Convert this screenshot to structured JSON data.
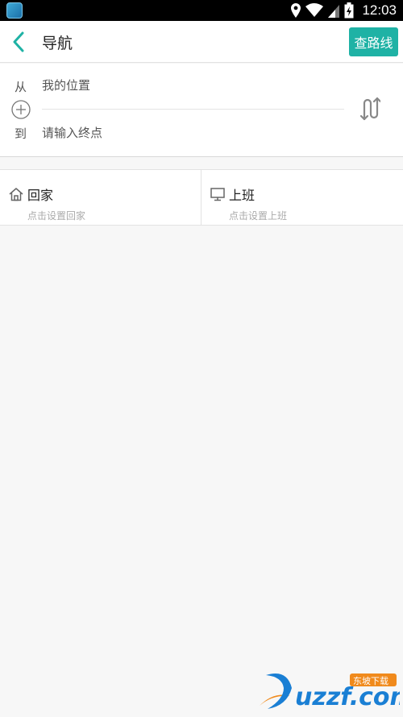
{
  "status_bar": {
    "time": "12:03"
  },
  "header": {
    "title": "导航",
    "search_button": "查路线"
  },
  "route": {
    "from_label": "从",
    "start_value": "我的位置",
    "to_label": "到",
    "end_placeholder": "请输入终点"
  },
  "shortcuts": {
    "home": {
      "title": "回家",
      "subtitle": "点击设置回家"
    },
    "work": {
      "title": "上班",
      "subtitle": "点击设置上班"
    }
  },
  "watermark": {
    "domain": "uzzf.com",
    "badge": "东坡下载"
  },
  "colors": {
    "accent": "#1fb2a5",
    "background": "#f7f7f7"
  }
}
